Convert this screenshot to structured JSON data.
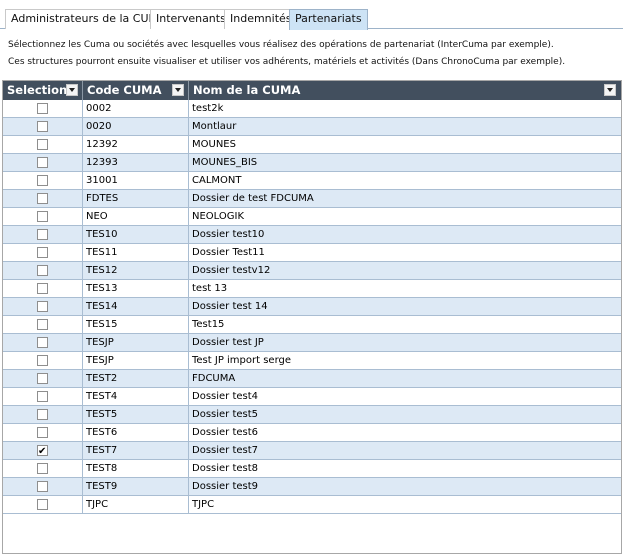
{
  "tabs": [
    {
      "label": "Administrateurs de la CUMA",
      "active": false
    },
    {
      "label": "Intervenants",
      "active": false
    },
    {
      "label": "Indemnités",
      "active": false
    },
    {
      "label": "Partenariats",
      "active": true
    }
  ],
  "description": {
    "line1": "Sélectionnez les Cuma ou sociétés avec lesquelles vous réalisez des opérations de partenariat (InterCuma par exemple).",
    "line2": "Ces structures pourront ensuite visualiser et utiliser vos adhérents, matériels et activités (Dans ChronoCuma par exemple)."
  },
  "grid": {
    "columns": [
      "Selection",
      "Code CUMA",
      "Nom de la CUMA"
    ],
    "header_color": "#424f5e",
    "alt_row_color": "#dde9f5",
    "rows": [
      {
        "selected": false,
        "code": "0002",
        "name": "test2k"
      },
      {
        "selected": false,
        "code": "0020",
        "name": "Montlaur"
      },
      {
        "selected": false,
        "code": "12392",
        "name": "MOUNES"
      },
      {
        "selected": false,
        "code": "12393",
        "name": "MOUNES_BIS"
      },
      {
        "selected": false,
        "code": "31001",
        "name": "CALMONT"
      },
      {
        "selected": false,
        "code": "FDTES",
        "name": "Dossier de test FDCUMA"
      },
      {
        "selected": false,
        "code": "NEO",
        "name": "NEOLOGIK"
      },
      {
        "selected": false,
        "code": "TES10",
        "name": "Dossier test10"
      },
      {
        "selected": false,
        "code": "TES11",
        "name": "Dossier Test11"
      },
      {
        "selected": false,
        "code": "TES12",
        "name": "Dossier testv12"
      },
      {
        "selected": false,
        "code": "TES13",
        "name": "test 13"
      },
      {
        "selected": false,
        "code": "TES14",
        "name": "Dossier test 14"
      },
      {
        "selected": false,
        "code": "TES15",
        "name": "Test15"
      },
      {
        "selected": false,
        "code": "TESJP",
        "name": "Dossier test JP"
      },
      {
        "selected": false,
        "code": "TESJP",
        "name": "Test JP import serge"
      },
      {
        "selected": false,
        "code": "TEST2",
        "name": "FDCUMA"
      },
      {
        "selected": false,
        "code": "TEST4",
        "name": "Dossier test4"
      },
      {
        "selected": false,
        "code": "TEST5",
        "name": "Dossier test5"
      },
      {
        "selected": false,
        "code": "TEST6",
        "name": "Dossier test6"
      },
      {
        "selected": true,
        "code": "TEST7",
        "name": "Dossier test7"
      },
      {
        "selected": false,
        "code": "TEST8",
        "name": "Dossier test8"
      },
      {
        "selected": false,
        "code": "TEST9",
        "name": "Dossier test9"
      },
      {
        "selected": false,
        "code": "TJPC",
        "name": "TJPC"
      }
    ]
  }
}
